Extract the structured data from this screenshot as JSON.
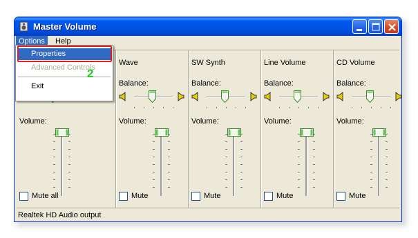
{
  "window": {
    "title": "Master Volume"
  },
  "menubar": {
    "options_label": "Options",
    "help_label": "Help"
  },
  "dropdown": {
    "items": [
      {
        "label": "Properties",
        "state": "highlighted"
      },
      {
        "label": "Advanced Controls",
        "state": "disabled"
      },
      {
        "label": "Exit",
        "state": "normal"
      }
    ]
  },
  "annotation": {
    "step_number": "2",
    "highlight_color": "#e02020",
    "number_color": "#22c81e"
  },
  "columns": [
    {
      "title": "",
      "balance_label": "",
      "volume_label": "Volume:",
      "mute_label": "Mute all",
      "mute_checked": false
    },
    {
      "title": "Wave",
      "balance_label": "Balance:",
      "volume_label": "Volume:",
      "mute_label": "Mute",
      "mute_checked": false
    },
    {
      "title": "SW Synth",
      "balance_label": "Balance:",
      "volume_label": "Volume:",
      "mute_label": "Mute",
      "mute_checked": false
    },
    {
      "title": "Line Volume",
      "balance_label": "Balance:",
      "volume_label": "Volume:",
      "mute_label": "Mute",
      "mute_checked": false
    },
    {
      "title": "CD Volume",
      "balance_label": "Balance:",
      "volume_label": "Volume:",
      "mute_label": "Mute",
      "mute_checked": false
    }
  ],
  "status": {
    "text": "Realtek HD Audio output"
  },
  "icons": {
    "app": "speaker-app-icon",
    "balance_left": "speaker-left-icon",
    "balance_right": "speaker-right-icon"
  },
  "colors": {
    "titlebar": "#0054e3",
    "menu_highlight": "#316ac5",
    "window_bg": "#ece9d8"
  }
}
